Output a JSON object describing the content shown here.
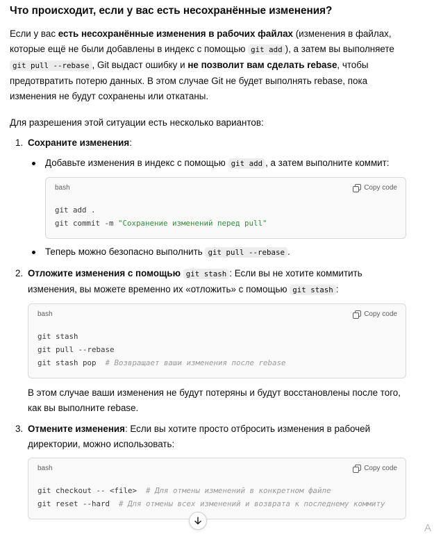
{
  "heading": "Что происходит, если у вас есть несохранённые изменения?",
  "intro": {
    "p1": "Если у вас ",
    "b1": "есть несохранённые изменения в рабочих файлах",
    "p2": " (изменения в файлах, которые ещё не были добавлены в индекс с помощью ",
    "c1": "git add",
    "p3": "), а затем вы выполняете ",
    "c2": "git pull --rebase",
    "p4": ", Git выдаст ошибку и ",
    "b2": "не позволит вам сделать rebase",
    "p5": ", чтобы предотвратить потерю данных. В этом случае Git не будет выполнять rebase, пока изменения не будут сохранены или откатаны."
  },
  "options_intro": "Для разрешения этой ситуации есть несколько вариантов:",
  "item1": {
    "num": "1.",
    "title": "Сохраните изменения",
    "colon": ":",
    "bullet1": {
      "t1": "Добавьте изменения в индекс с помощью ",
      "c1": "git add",
      "t2": ", а затем выполните коммит:"
    },
    "code": {
      "lang": "bash",
      "copy": "Copy code",
      "line1": "git add .",
      "line2_cmd": "git commit -m ",
      "line2_str": "\"Сохранение изменений перед pull\""
    },
    "bullet2": {
      "t1": "Теперь можно безопасно выполнить ",
      "c1": "git pull --rebase",
      "t2": "."
    }
  },
  "item2": {
    "num": "2.",
    "title": "Отложите изменения с помощью ",
    "title_code": "git stash",
    "t1": ": Если вы не хотите коммитить изменения, вы можете временно их «отложить» с помощью ",
    "c1": "git stash",
    "t2": ":",
    "code": {
      "lang": "bash",
      "copy": "Copy code",
      "line1": "git stash",
      "line2": "git pull --rebase",
      "line3_cmd": "git stash pop  ",
      "line3_cmt": "# Возвращает ваши изменения после rebase"
    },
    "after": "В этом случае ваши изменения не будут потеряны и будут восстановлены после того, как вы выполните rebase."
  },
  "item3": {
    "num": "3.",
    "title": "Отмените изменения",
    "t1": ": Если вы хотите просто отбросить изменения в рабочей директории, можно использовать:",
    "code": {
      "lang": "bash",
      "copy": "Copy code",
      "line1_cmd": "git checkout -- <file>  ",
      "line1_cmt": "# Для отмены изменений в конкретном файле",
      "line2_cmd": "git reset --hard  ",
      "line2_cmt": "# Для отмены всех изменений и возврата к последнему коммиту"
    }
  },
  "icons": {
    "copy": "copy-icon",
    "scroll": "arrow-down-icon"
  },
  "corner_glyph": "A"
}
